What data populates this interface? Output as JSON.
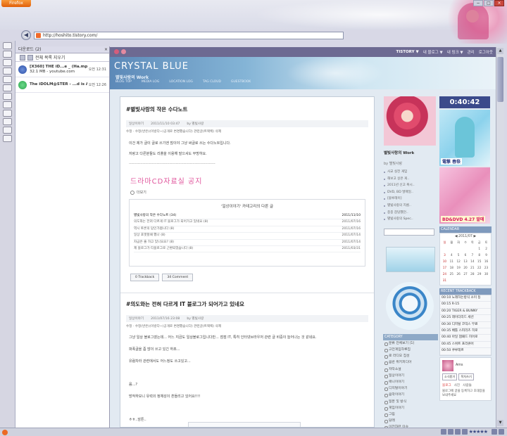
{
  "browser": {
    "app_button": "Firefox",
    "url": "http://hoshito.tistory.com/"
  },
  "sidebar": {
    "title": "다운로드 (2)",
    "clear_label": "전체 목록 지우기",
    "downloads": [
      {
        "name": "[X360] THE iD...e _ (Ha.mp4",
        "detail": "32.1 MB - youtube.com",
        "time": "오전 12:31"
      },
      {
        "name": "The iDOLM@STER - ...d is All One.mp4",
        "detail": "",
        "time": "오전 12:26"
      }
    ]
  },
  "tistory_bar": {
    "logo": "TISTORY ▼",
    "links": [
      "내 블로그 ▼",
      "내 링크 ▼",
      "관리",
      "로그아웃"
    ]
  },
  "header": {
    "title": "CRYSTAL BLUE",
    "subtitle": "별빛사랑의 Work",
    "menu": [
      "BLOG TOP",
      "MEDIA LOG",
      "LOCATION LOG",
      "TAG CLOUD",
      "GUESTBOOK"
    ]
  },
  "post1": {
    "title": "#별빛사랑의 작은 수다노트",
    "meta": [
      "일상이야기",
      "2011/11/10 03:47",
      "by 별빛사랑"
    ],
    "tags": "수정 · 수정(반은)(이방다~(공개로 변경했습니다) 관련글(트랙백) 삭제",
    "p1": "이건 제가 글이 글로 쓰기엔 많이야 그냥 써글로 쓰는 수다노트입니다.",
    "p2": "저랑고 다른분들도 리플을 이용해 말으셔도 무방하요.",
    "rule": "--------------------------------------------------------------------",
    "pink": "드라마CD자료실 공지",
    "more": "더보기",
    "cat_title": "'일상이야기' 카테고리의 다른 글",
    "cat_rows": [
      {
        "text": "별빛사랑의 작은 수다노트 (34)",
        "date": "2011/11/10"
      },
      {
        "text": "의도와는 전혀 다르게 IT 블로그가 되어가고 있네요 (8)",
        "date": "2011/07/16"
      },
      {
        "text": "역시 토론의 답인가봅니다 (8)",
        "date": "2011/07/16"
      },
      {
        "text": "일상 포맷할때 했나 (8)",
        "date": "2011/07/14"
      },
      {
        "text": "자금은 줄 하고 있나요요? (8)",
        "date": "2011/07/14"
      },
      {
        "text": "제 블로그가 티블로그로 근환되었습니다 (8)",
        "date": "2011/03/31"
      }
    ],
    "buttons": [
      "0 Trackback",
      "34 Comment"
    ]
  },
  "post2": {
    "title": "#의도와는 전혀 다르게 IT 블로그가 되어가고 있네요",
    "meta": [
      "일상이야기",
      "2011/07/16 23:08",
      "by 별빛사랑"
    ],
    "tags": "수정 · 수정(반은)(이방다~(공개로 변경했습니다) 관련글(트랙백) 삭제",
    "paras": [
      "그냥 일상 블로그였는데... 어느 지금도 일상블로그입니다만... 점점 IT, 특히 인터넷브라우저 관련 글 비중이 늘어나는 것 같네요.",
      "파폭글을 좀 많이 쓰고 있긴 하죠...",
      "유람차라 관련에서도 어느정도 쓰고있고...",
      "음...?",
      "방작하보니 유럭의 정체성이 흔들리고 있어요!!!!",
      "ㅎㅎ..암튼.."
    ]
  },
  "middle": {
    "caption": "별빛사랑의 Work",
    "by": "by 별빛사랑",
    "links": [
      "사교 실전 게임",
      "해보고 싶은 게..",
      "2011년 신고 혹시..",
      "DVD, BD 발매일..",
      "[블루레이]",
      "별빛사랑의 지름..",
      "종종 잡담했던..",
      "별빛사랑의 Spec.."
    ],
    "category_header": "CATEGORY",
    "categories": [
      "분류 전체보기 (1)",
      "고전게임하루집",
      "로 라디오 집성",
      "음반 위키피디아",
      "쟈작소설",
      "일상이야기",
      "애니이야기",
      "디지털이야기",
      "음악이야기",
      "일본 및 방식",
      "게임이야기",
      "그림",
      "당래",
      "이전하련 이슈",
      "자라작 방송",
      "정보공사 (공략방식)",
      "디렉토리",
      "창작방"
    ]
  },
  "right": {
    "clock": "0:40:42",
    "ad1_caption": "電撃 春祭",
    "ad2_caption": "BD&DVD 4.27 발매",
    "calendar_header": "CALENDAR",
    "calendar_month": "◀ 2011/07 ▶",
    "calendar_days": [
      "일",
      "월",
      "화",
      "수",
      "목",
      "금",
      "토",
      "",
      "",
      "",
      "",
      "",
      "1",
      "2",
      "3",
      "4",
      "5",
      "6",
      "7",
      "8",
      "9",
      "10",
      "11",
      "12",
      "13",
      "14",
      "15",
      "16",
      "17",
      "18",
      "19",
      "20",
      "21",
      "22",
      "23",
      "24",
      "25",
      "26",
      "27",
      "28",
      "29",
      "30",
      "31",
      "",
      "",
      "",
      "",
      "",
      ""
    ],
    "trackback_header": "RECENT TRACKBACK",
    "trackbacks": [
      "00:10 노래하는방식 소이 등",
      "00:15 R-15",
      "00:20 TIGER & BUNNY",
      "00:25 레이더리드 세션",
      "00:30 디지털 코믹스 무료",
      "00:35 배틀 스피리츠 히로",
      "00:40 아일 잼패드 히어로",
      "00:45 스위트 프리큐어",
      "00:50 쿠루테르"
    ],
    "profile_name": "Ams",
    "profile_buttons": [
      "소식받기",
      "목차쓰기"
    ],
    "profile_links": [
      "블로그",
      "사진",
      "사람들"
    ],
    "invite": "블로그에 글을 등록하고 초대장을 보내주세요"
  }
}
